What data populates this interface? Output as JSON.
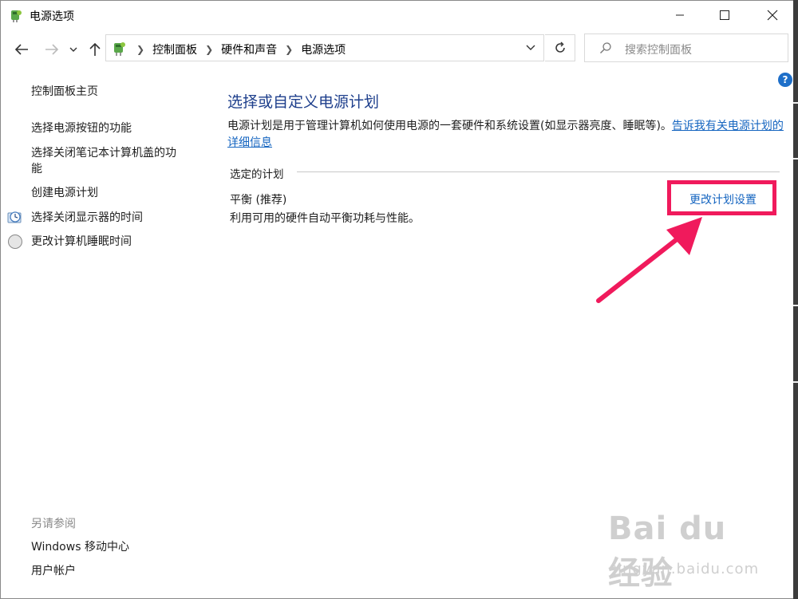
{
  "window": {
    "title": "电源选项",
    "minimize_icon": "minimize-icon",
    "maximize_icon": "maximize-icon",
    "close_icon": "close-icon"
  },
  "address_bar": {
    "breadcrumbs": [
      "控制面板",
      "硬件和声音",
      "电源选项"
    ],
    "search_placeholder": "搜索控制面板"
  },
  "sidebar": {
    "home_link": "控制面板主页",
    "links": [
      {
        "label": "选择电源按钮的功能",
        "icon": ""
      },
      {
        "label": "选择关闭笔记本计算机盖的功\n能",
        "icon": ""
      },
      {
        "label": "创建电源计划",
        "icon": ""
      },
      {
        "label": "选择关闭显示器的时间",
        "icon": "clock-monitor-icon"
      },
      {
        "label": "更改计算机睡眠时间",
        "icon": "moon-sleep-icon"
      }
    ],
    "see_also_label": "另请参阅",
    "see_also_links": [
      "Windows 移动中心",
      "用户帐户"
    ]
  },
  "main": {
    "heading": "选择或自定义电源计划",
    "description_text": "电源计划是用于管理计算机如何使用电源的一套硬件和系统设置(如显示器亮度、睡眠等)。",
    "description_link": "告诉我有关电源计划的详细信息",
    "selected_plan_label": "选定的计划",
    "plan_name": "平衡 (推荐)",
    "plan_description": "利用可用的硬件自动平衡功耗与性能。",
    "change_plan_link": "更改计划设置"
  },
  "watermark": {
    "main": "Bai du 经验",
    "sub": "jingyan.baidu.com"
  },
  "colors": {
    "heading": "#1e3f8c",
    "link": "#1565c0",
    "highlight": "#f01a5c"
  }
}
